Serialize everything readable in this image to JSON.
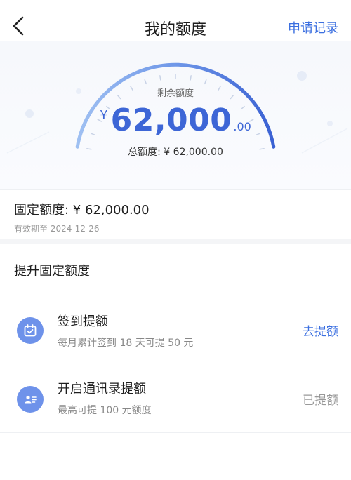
{
  "header": {
    "title": "我的额度",
    "records_label": "申请记录",
    "back_icon": "chevron-left-icon"
  },
  "quota": {
    "remain_label": "剩余额度",
    "currency": "¥",
    "amount_integer": "62,000",
    "amount_decimal": ".00",
    "total_text": "总额度: ¥ 62,000.00",
    "remaining_fraction": 1.0
  },
  "fixed": {
    "line": "固定额度: ¥ 62,000.00",
    "valid_until": "有效期至 2024-12-26"
  },
  "boost": {
    "section_title": "提升固定额度",
    "items": [
      {
        "name": "签到提额",
        "desc": "每月累计签到 18 天可提 50 元",
        "action": "去提额",
        "icon": "calendar-check-icon"
      },
      {
        "name": "开启通讯录提额",
        "desc": "最高可提 100 元额度",
        "action": "已提额",
        "icon": "contact-card-icon"
      }
    ]
  },
  "colors": {
    "accent": "#3b6fe0",
    "amount": "#3d66d6",
    "icon_bg": "#6e92ea"
  }
}
